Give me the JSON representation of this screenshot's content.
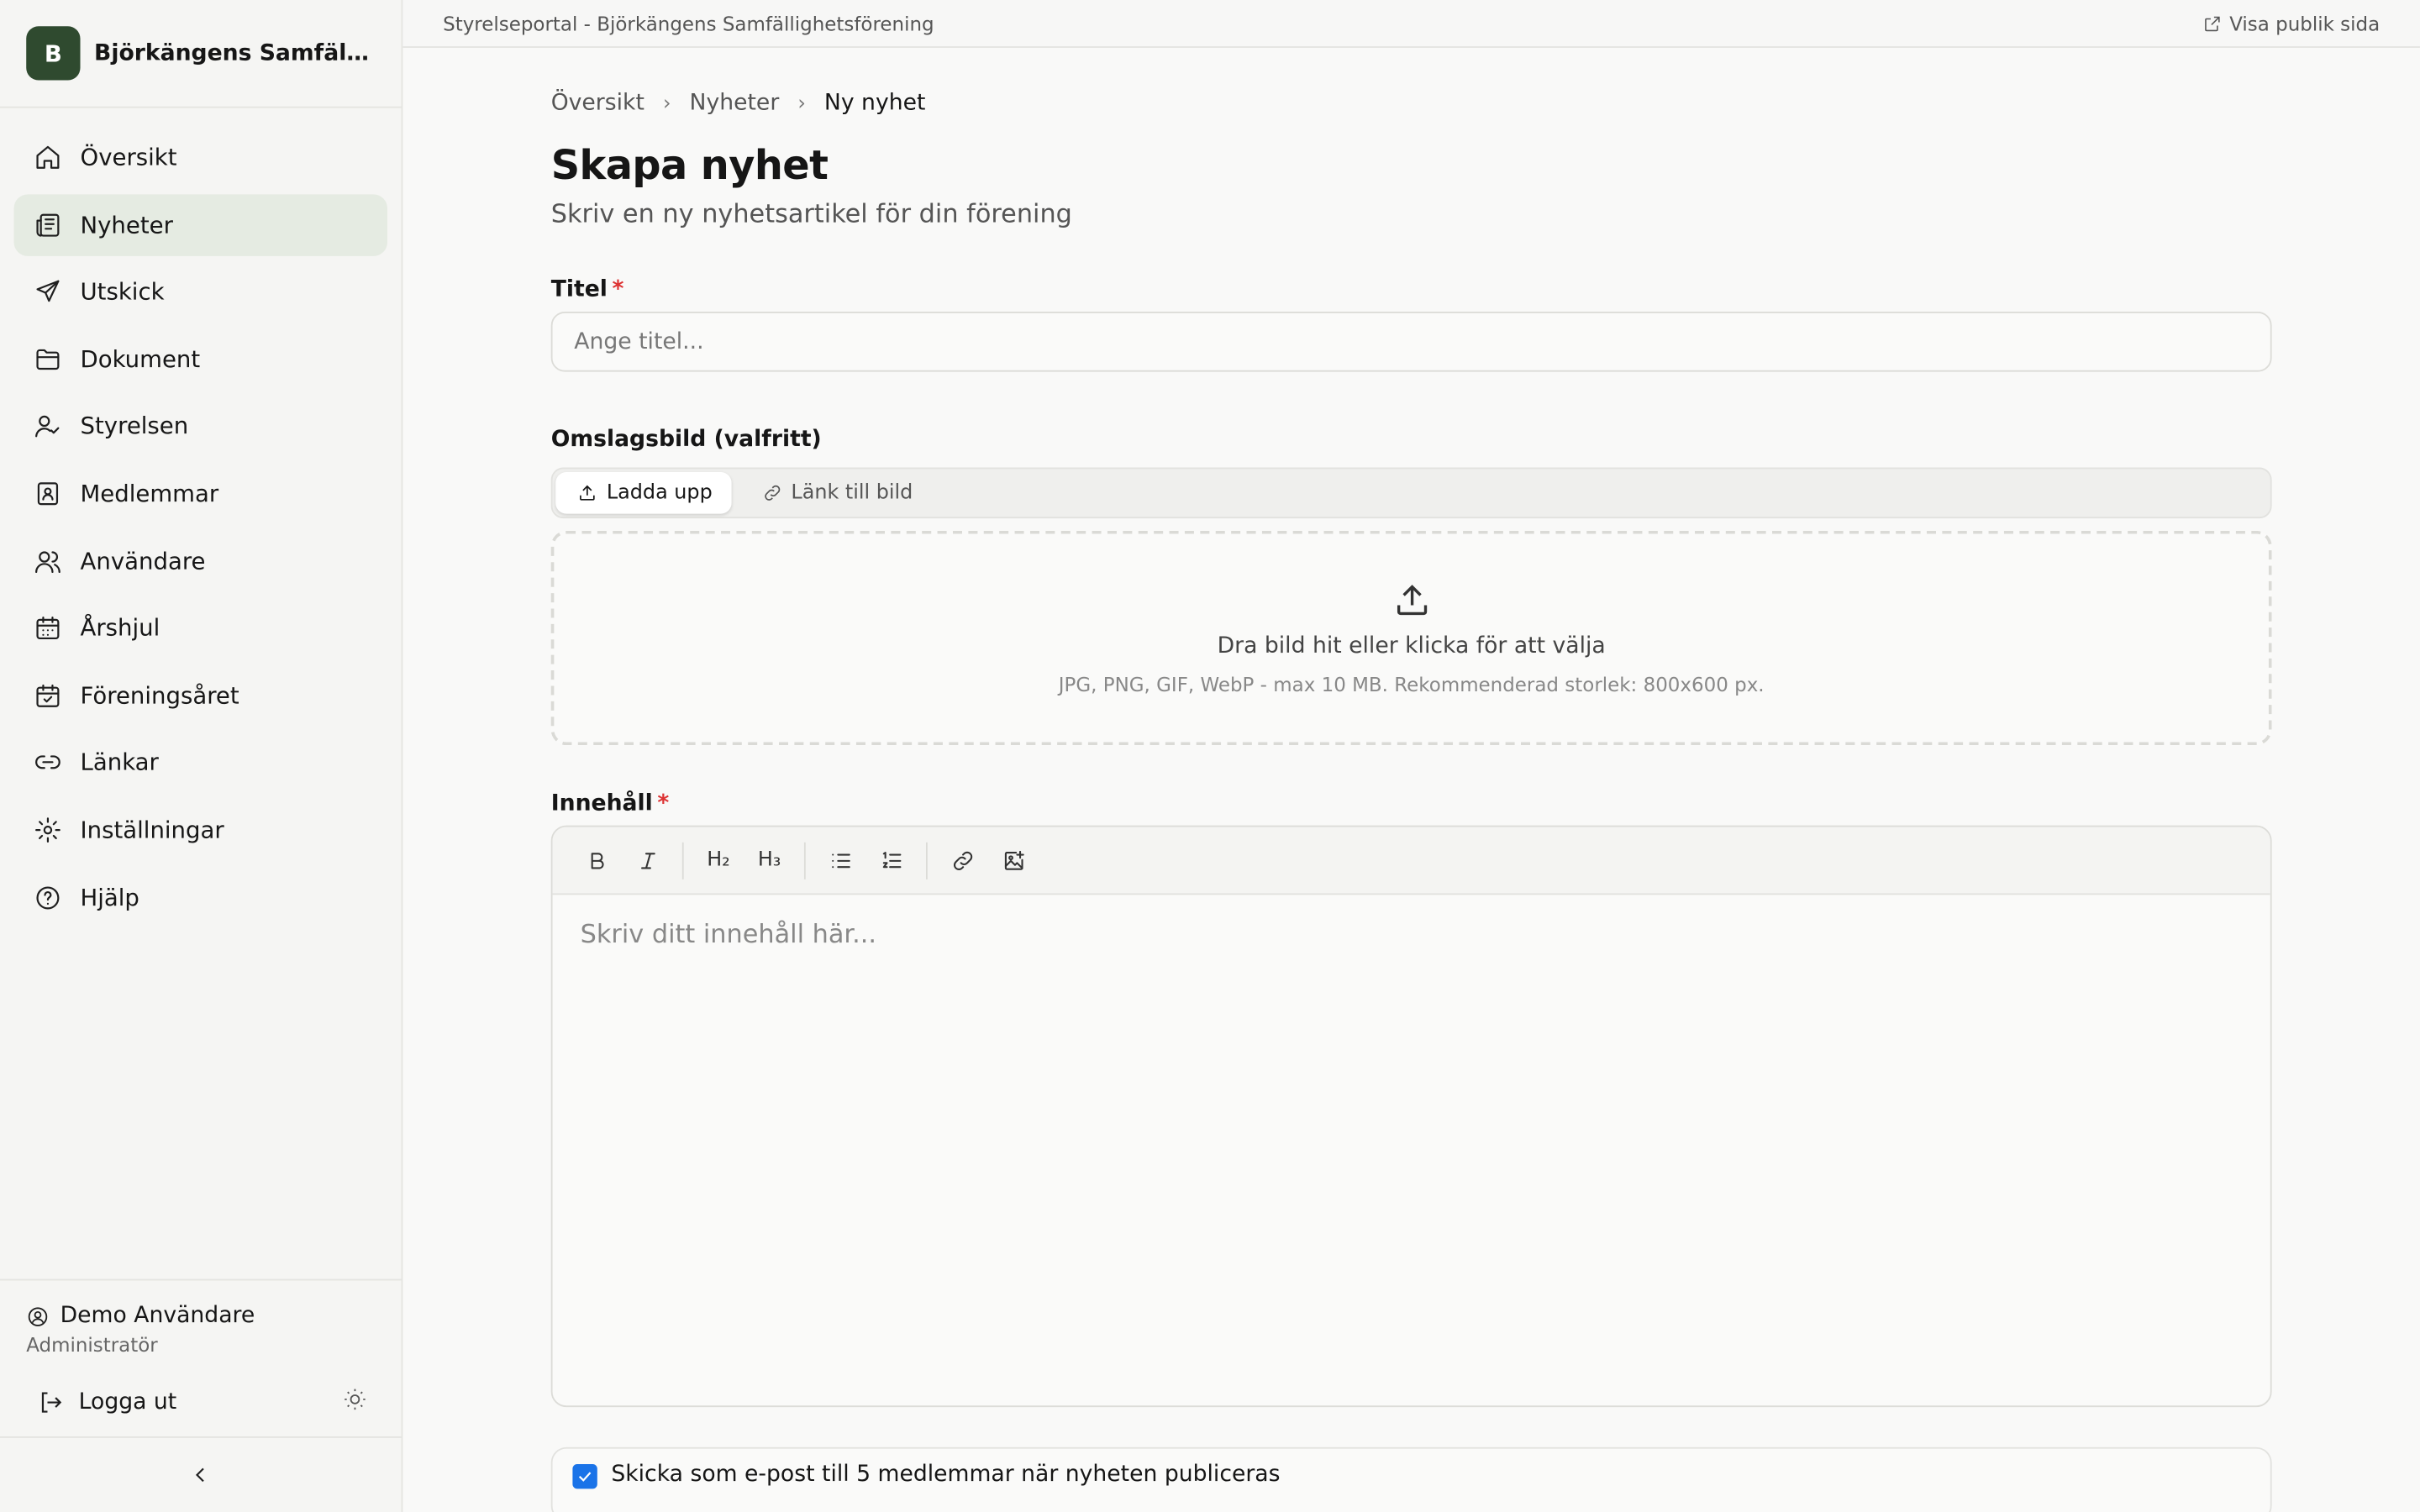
{
  "brand": {
    "initial": "B",
    "name": "Björkängens Samfällig..."
  },
  "sidebar": {
    "items": [
      {
        "label": "Översikt",
        "icon": "home-icon"
      },
      {
        "label": "Nyheter",
        "icon": "newspaper-icon"
      },
      {
        "label": "Utskick",
        "icon": "send-icon"
      },
      {
        "label": "Dokument",
        "icon": "folder-icon"
      },
      {
        "label": "Styrelsen",
        "icon": "user-check-icon"
      },
      {
        "label": "Medlemmar",
        "icon": "contact-book-icon"
      },
      {
        "label": "Användare",
        "icon": "users-icon"
      },
      {
        "label": "Årshjul",
        "icon": "calendar-grid-icon"
      },
      {
        "label": "Föreningsåret",
        "icon": "calendar-check-icon"
      },
      {
        "label": "Länkar",
        "icon": "link-icon"
      },
      {
        "label": "Inställningar",
        "icon": "gear-icon"
      },
      {
        "label": "Hjälp",
        "icon": "help-circle-icon"
      }
    ],
    "active_item": "Nyheter",
    "user": {
      "name": "Demo Användare",
      "role": "Administratör"
    },
    "logout_label": "Logga ut"
  },
  "topbar": {
    "title": "Styrelseportal - Björkängens Samfällighetsförening",
    "public_link": "Visa publik sida"
  },
  "breadcrumb": [
    "Översikt",
    "Nyheter",
    "Ny nyhet"
  ],
  "page": {
    "title": "Skapa nyhet",
    "subtitle": "Skriv en ny nyhetsartikel för din förening"
  },
  "form": {
    "title_label": "Titel",
    "required_mark": "*",
    "title_placeholder": "Ange titel...",
    "cover_label": "Omslagsbild (valfritt)",
    "cover_tabs": [
      {
        "label": "Ladda upp",
        "active": true
      },
      {
        "label": "Länk till bild",
        "active": false
      }
    ],
    "dropzone_text": "Dra bild hit eller klicka för att välja",
    "dropzone_hint": "JPG, PNG, GIF, WebP - max 10 MB. Rekommenderad storlek: 800x600 px.",
    "content_label": "Innehåll",
    "toolbar": {
      "h2": "H₂",
      "h3": "H₃"
    },
    "content_placeholder": "Skriv ditt innehåll här...",
    "email_checkbox_label": "Skicka som e-post till 5 medlemmar när nyheten publiceras",
    "email_checked": true
  },
  "colors": {
    "accent": "#2f4a2f",
    "active_nav_bg": "#e5ebe2",
    "checkbox": "#1a73e8",
    "required": "#dd3333"
  }
}
